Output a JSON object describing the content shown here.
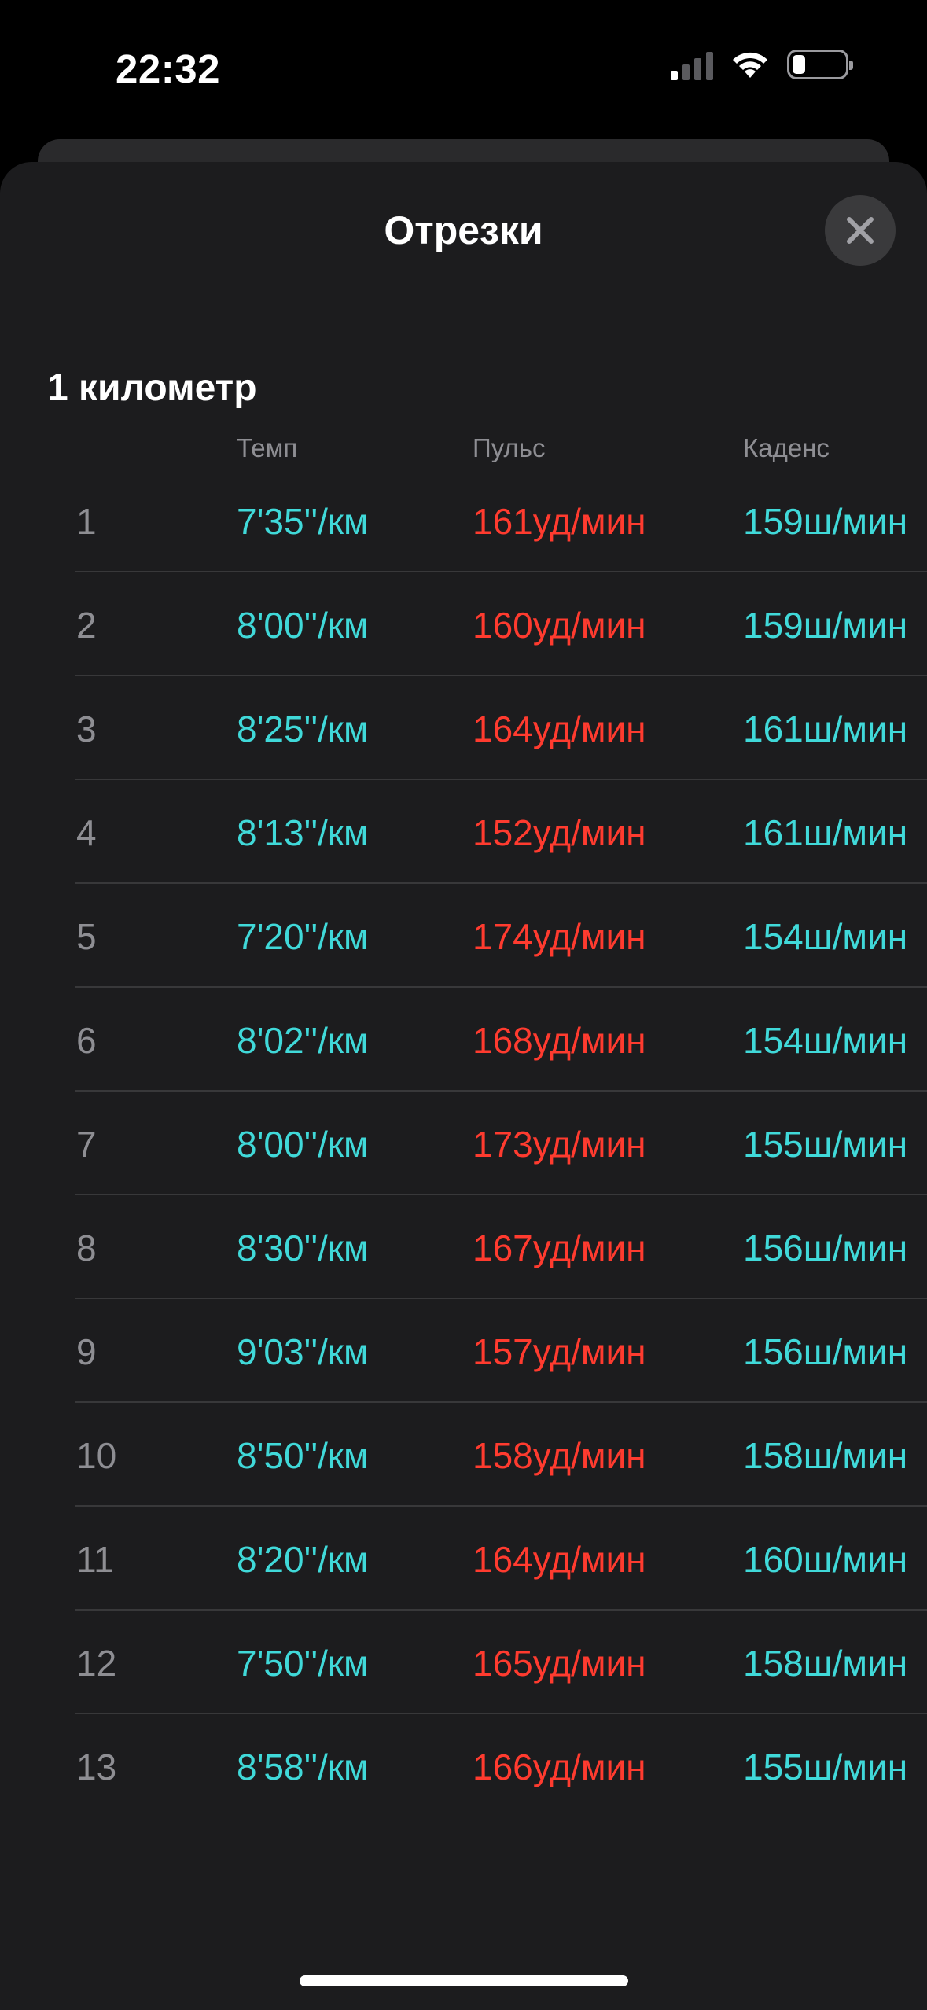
{
  "status": {
    "time": "22:32"
  },
  "sheet": {
    "title": "Отрезки",
    "section_title": "1 километр",
    "columns": {
      "pace": "Темп",
      "hr": "Пульс",
      "cadence": "Каденс"
    },
    "splits": [
      {
        "num": "1",
        "pace": "7'35''/км",
        "hr": "161уд/мин",
        "cadence": "159ш/мин"
      },
      {
        "num": "2",
        "pace": "8'00''/км",
        "hr": "160уд/мин",
        "cadence": "159ш/мин"
      },
      {
        "num": "3",
        "pace": "8'25''/км",
        "hr": "164уд/мин",
        "cadence": "161ш/мин"
      },
      {
        "num": "4",
        "pace": "8'13''/км",
        "hr": "152уд/мин",
        "cadence": "161ш/мин"
      },
      {
        "num": "5",
        "pace": "7'20''/км",
        "hr": "174уд/мин",
        "cadence": "154ш/мин"
      },
      {
        "num": "6",
        "pace": "8'02''/км",
        "hr": "168уд/мин",
        "cadence": "154ш/мин"
      },
      {
        "num": "7",
        "pace": "8'00''/км",
        "hr": "173уд/мин",
        "cadence": "155ш/мин"
      },
      {
        "num": "8",
        "pace": "8'30''/км",
        "hr": "167уд/мин",
        "cadence": "156ш/мин"
      },
      {
        "num": "9",
        "pace": "9'03''/км",
        "hr": "157уд/мин",
        "cadence": "156ш/мин"
      },
      {
        "num": "10",
        "pace": "8'50''/км",
        "hr": "158уд/мин",
        "cadence": "158ш/мин"
      },
      {
        "num": "11",
        "pace": "8'20''/км",
        "hr": "164уд/мин",
        "cadence": "160ш/мин"
      },
      {
        "num": "12",
        "pace": "7'50''/км",
        "hr": "165уд/мин",
        "cadence": "158ш/мин"
      },
      {
        "num": "13",
        "pace": "8'58''/км",
        "hr": "166уд/мин",
        "cadence": "155ш/мин"
      }
    ]
  },
  "colors": {
    "pace": "#40d9d9",
    "hr": "#ff3b2f",
    "cadence": "#40d9d9",
    "background": "#1c1c1e"
  }
}
